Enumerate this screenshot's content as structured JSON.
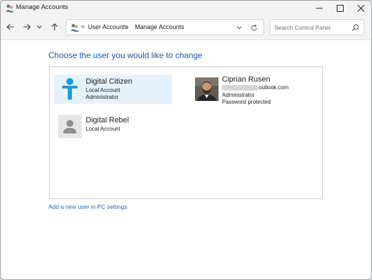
{
  "window": {
    "title": "Manage Accounts"
  },
  "address_bar": {
    "separator": "«",
    "breadcrumbs": [
      "User Accounts",
      "Manage Accounts"
    ],
    "arrow": "›"
  },
  "search": {
    "placeholder": "Search Control Panel"
  },
  "main": {
    "heading": "Choose the user you would like to change",
    "accounts": [
      {
        "name": "Digital Citizen",
        "lines": [
          "Local Account",
          "Administrator"
        ],
        "selected": true,
        "avatar": "person-silhouette-icon",
        "color": "#1a9bdc"
      },
      {
        "name": "Digital Rebel",
        "lines": [
          "Local Account"
        ],
        "selected": false,
        "avatar": "default-user-icon",
        "color": "#8e8e8e"
      },
      {
        "name": "Ciprian Rusen",
        "email_suffix": "outlook.com",
        "lines": [
          "Administrator",
          "Password protected"
        ],
        "selected": false,
        "avatar": "user-photo"
      }
    ],
    "add_user_link": "Add a new user in PC settings"
  },
  "colors": {
    "accent": "#1e5aa8",
    "link": "#1a66c2",
    "selected_bg": "#e5f1fb"
  }
}
